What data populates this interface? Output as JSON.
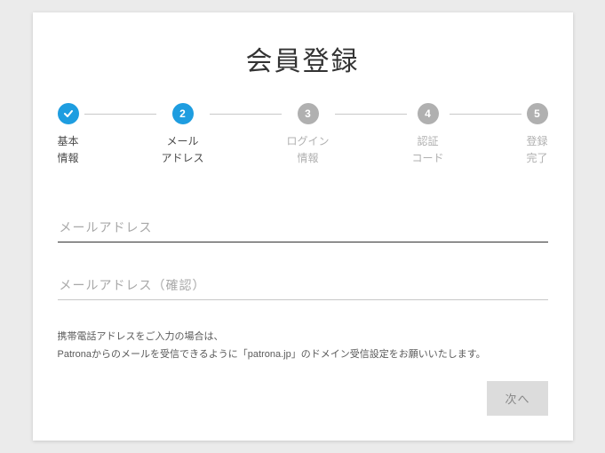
{
  "title": "会員登録",
  "steps": [
    {
      "num": "✓",
      "label_line1": "基本",
      "label_line2": "情報",
      "state": "done"
    },
    {
      "num": "2",
      "label_line1": "メール",
      "label_line2": "アドレス",
      "state": "active"
    },
    {
      "num": "3",
      "label_line1": "ログイン",
      "label_line2": "情報",
      "state": "pending"
    },
    {
      "num": "4",
      "label_line1": "認証",
      "label_line2": "コード",
      "state": "pending"
    },
    {
      "num": "5",
      "label_line1": "登録",
      "label_line2": "完了",
      "state": "pending"
    }
  ],
  "fields": {
    "email_placeholder": "メールアドレス",
    "email_confirm_placeholder": "メールアドレス（確認）"
  },
  "note_line1": "携帯電話アドレスをご入力の場合は、",
  "note_line2": "Patronaからのメールを受信できるように「patrona.jp」のドメイン受信設定をお願いいたします。",
  "next_button": "次へ"
}
